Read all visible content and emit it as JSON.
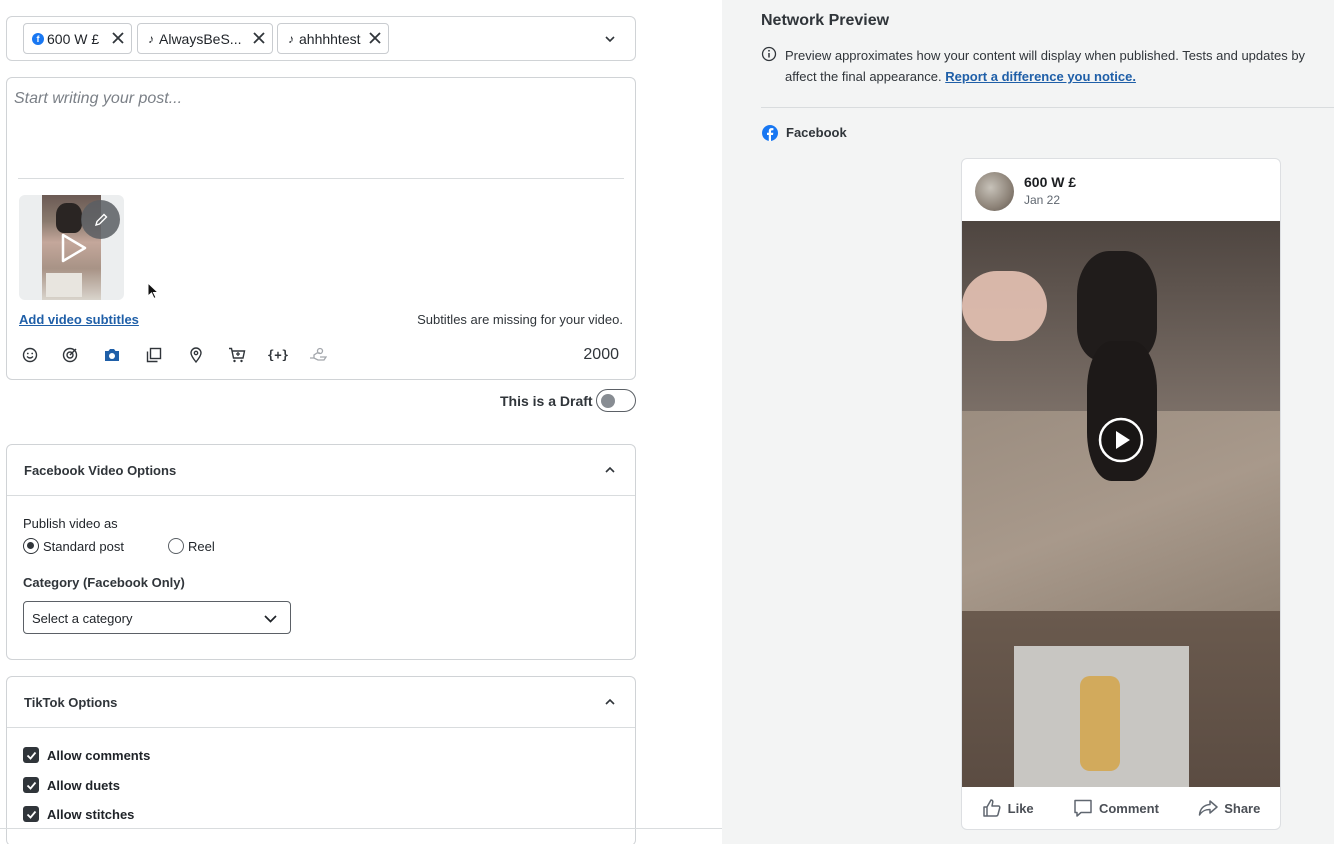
{
  "composer": {
    "profiles": [
      {
        "network": "facebook",
        "label": "600 W £"
      },
      {
        "network": "tiktok",
        "label": "AlwaysBeS..."
      },
      {
        "network": "tiktok",
        "label": "ahhhhtest"
      }
    ],
    "placeholder": "Start writing your post...",
    "add_subtitles": "Add video subtitles",
    "subtitles_missing": "Subtitles are missing for your video.",
    "char_count": "2000",
    "toolbar_icons": [
      "emoji-icon",
      "target-icon",
      "camera-icon",
      "gallery-icon",
      "location-icon",
      "cart-icon",
      "variable-icon",
      "hand-icon"
    ]
  },
  "draft": {
    "label": "This is a Draft",
    "on": false
  },
  "facebook_options": {
    "title": "Facebook Video Options",
    "publish_label": "Publish video as",
    "options": [
      "Standard post",
      "Reel"
    ],
    "selected": "Standard post",
    "category_label": "Category (Facebook Only)",
    "category_placeholder": "Select a category"
  },
  "tiktok_options": {
    "title": "TikTok Options",
    "checks": [
      {
        "label": "Allow comments",
        "checked": true
      },
      {
        "label": "Allow duets",
        "checked": true
      },
      {
        "label": "Allow stitches",
        "checked": true
      }
    ]
  },
  "preview": {
    "title": "Network Preview",
    "info": "Preview approximates how your content will display when published. Tests and updates by",
    "info_line2": "affect the final appearance.",
    "link": "Report a difference you notice.",
    "network_label": "Facebook",
    "post": {
      "name": "600 W £",
      "date": "Jan 22",
      "actions": [
        "Like",
        "Comment",
        "Share"
      ]
    }
  },
  "colors": {
    "facebook_blue": "#1877f2",
    "link": "#1f5fa8",
    "preview_bg": "#f3f4f4"
  }
}
